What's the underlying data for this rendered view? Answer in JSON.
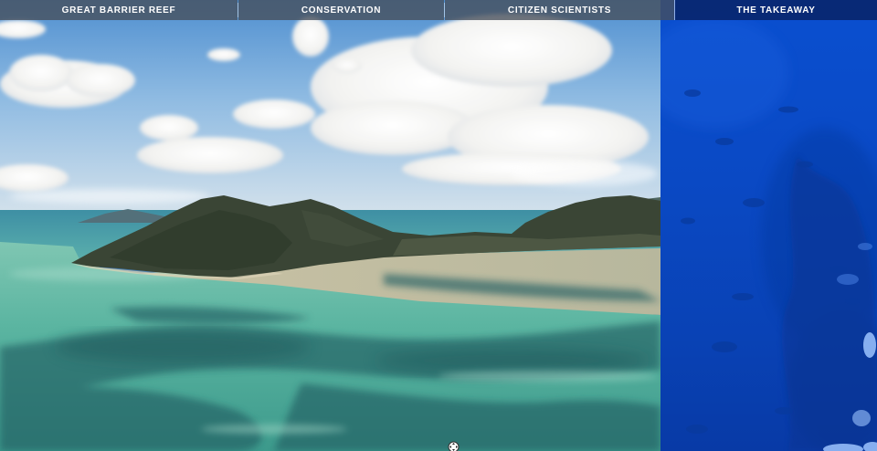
{
  "nav": {
    "items": [
      {
        "label": "GREAT BARRIER REEF"
      },
      {
        "label": "CONSERVATION"
      },
      {
        "label": "CITIZEN SCIENTISTS"
      },
      {
        "label": "THE TAKEAWAY"
      }
    ]
  },
  "colors": {
    "ocean_panel": "#0a4fd0",
    "nav_dim": "#464e5a",
    "nav_dark": "#09266e",
    "lagoon_turquoise": "#5fb8a6",
    "sky_blue": "#6fa7d8"
  },
  "icons": {
    "cursor": "move-cursor-icon"
  }
}
